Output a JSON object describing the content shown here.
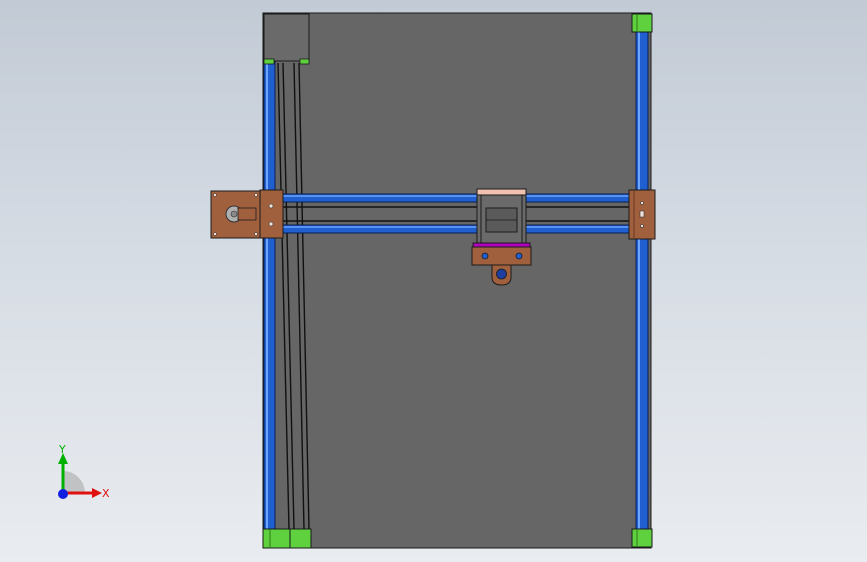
{
  "view": {
    "background_top": "#c2cad5",
    "background_bottom": "#e9ecf0"
  },
  "model": {
    "colors": {
      "base_plate": "#666666",
      "rail_blue": "#1f5fd0",
      "rail_highlight": "#6fa4ff",
      "corner_green": "#5fd13e",
      "bracket_copper": "#a0603e",
      "carriage_gray": "#6a6a6a",
      "carriage_pink": "#f0c0b0",
      "carriage_magenta": "#b000c0",
      "motor_box": "#6a6a6a",
      "outline": "#1a1a1a"
    }
  },
  "triad": {
    "y_label": "Y",
    "x_label": "X",
    "y_color": "#00b000",
    "x_color": "#e01010",
    "z_color": "#1020e0"
  }
}
